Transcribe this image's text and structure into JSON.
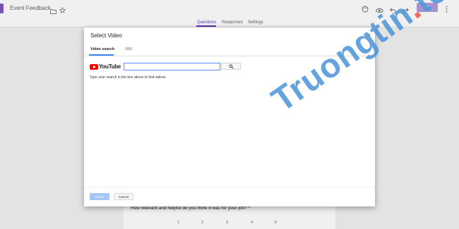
{
  "app": {
    "form_title": "Event Feedback",
    "send_label": "Send",
    "tabs": [
      {
        "label": "Questions",
        "active": true
      },
      {
        "label": "Responses",
        "active": false
      },
      {
        "label": "Settings",
        "active": false
      }
    ],
    "accent_color": "#673ab7"
  },
  "background_form": {
    "question": "How relevant and helpful do you think it was for your job? *",
    "scale": [
      "1",
      "2",
      "3",
      "4",
      "5"
    ]
  },
  "dialog": {
    "title": "Select Video",
    "close": "×",
    "tabs": [
      {
        "label": "Video search",
        "active": true
      },
      {
        "label": "URL",
        "active": false
      }
    ],
    "provider": "YouTube",
    "search_value": "",
    "hint": "Type your search in the box above to find videos.",
    "select_label": "Select",
    "cancel_label": "Cancel"
  },
  "watermark": {
    "main": "Truongtin",
    "dot": ".",
    "suffix": "top"
  }
}
